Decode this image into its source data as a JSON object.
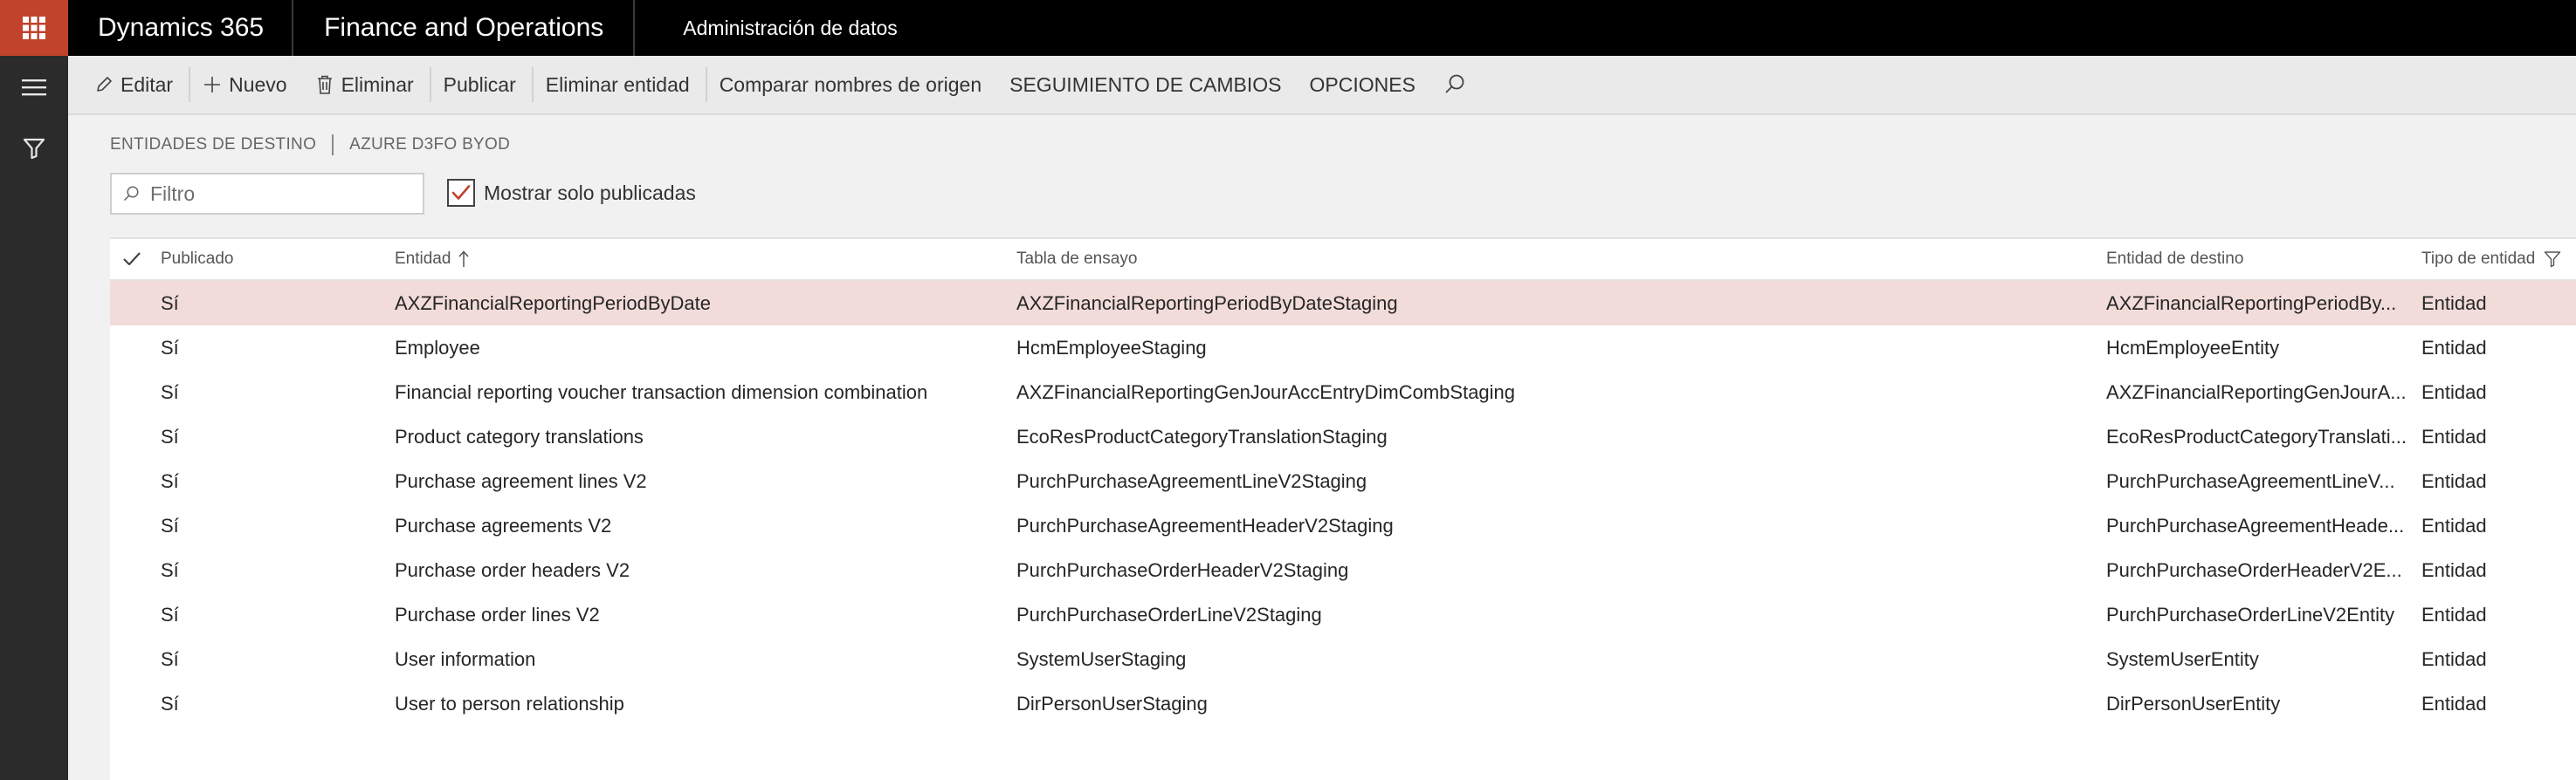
{
  "topbar": {
    "waffle_icon": "app-launcher-icon",
    "product": "Dynamics 365",
    "app": "Finance and Operations",
    "module": "Administración de datos"
  },
  "colors": {
    "topbar": "#000000",
    "waffle": "#c1432c",
    "rail": "#2b2b2b",
    "selected_row": "#f2dcd9"
  },
  "actions": {
    "edit": "Editar",
    "new": "Nuevo",
    "delete": "Eliminar",
    "publish": "Publicar",
    "delete_entity": "Eliminar entidad",
    "compare": "Comparar nombres de origen",
    "tracking": "SEGUIMIENTO DE CAMBIOS",
    "options": "OPCIONES"
  },
  "breadcrumb": {
    "first": "ENTIDADES DE DESTINO",
    "second": "AZURE D3FO BYOD"
  },
  "filter": {
    "placeholder": "Filtro"
  },
  "show_published": {
    "label": "Mostrar solo publicadas",
    "checked": true
  },
  "grid": {
    "headers": {
      "published": "Publicado",
      "entity": "Entidad",
      "staging": "Tabla de ensayo",
      "target": "Entidad de destino",
      "type": "Tipo de entidad"
    },
    "rows": [
      {
        "published": "Sí",
        "entity": "AXZFinancialReportingPeriodByDate",
        "staging": "AXZFinancialReportingPeriodByDateStaging",
        "target": "AXZFinancialReportingPeriodBy...",
        "type": "Entidad"
      },
      {
        "published": "Sí",
        "entity": "Employee",
        "staging": "HcmEmployeeStaging",
        "target": "HcmEmployeeEntity",
        "type": "Entidad"
      },
      {
        "published": "Sí",
        "entity": "Financial reporting voucher transaction dimension combination",
        "staging": "AXZFinancialReportingGenJourAccEntryDimCombStaging",
        "target": "AXZFinancialReportingGenJourA...",
        "type": "Entidad"
      },
      {
        "published": "Sí",
        "entity": "Product category translations",
        "staging": "EcoResProductCategoryTranslationStaging",
        "target": "EcoResProductCategoryTranslati...",
        "type": "Entidad"
      },
      {
        "published": "Sí",
        "entity": "Purchase agreement lines V2",
        "staging": "PurchPurchaseAgreementLineV2Staging",
        "target": "PurchPurchaseAgreementLineV...",
        "type": "Entidad"
      },
      {
        "published": "Sí",
        "entity": "Purchase agreements V2",
        "staging": "PurchPurchaseAgreementHeaderV2Staging",
        "target": "PurchPurchaseAgreementHeade...",
        "type": "Entidad"
      },
      {
        "published": "Sí",
        "entity": "Purchase order headers V2",
        "staging": "PurchPurchaseOrderHeaderV2Staging",
        "target": "PurchPurchaseOrderHeaderV2E...",
        "type": "Entidad"
      },
      {
        "published": "Sí",
        "entity": "Purchase order lines V2",
        "staging": "PurchPurchaseOrderLineV2Staging",
        "target": "PurchPurchaseOrderLineV2Entity",
        "type": "Entidad"
      },
      {
        "published": "Sí",
        "entity": "User information",
        "staging": "SystemUserStaging",
        "target": "SystemUserEntity",
        "type": "Entidad"
      },
      {
        "published": "Sí",
        "entity": "User to person relationship",
        "staging": "DirPersonUserStaging",
        "target": "DirPersonUserEntity",
        "type": "Entidad"
      }
    ]
  }
}
